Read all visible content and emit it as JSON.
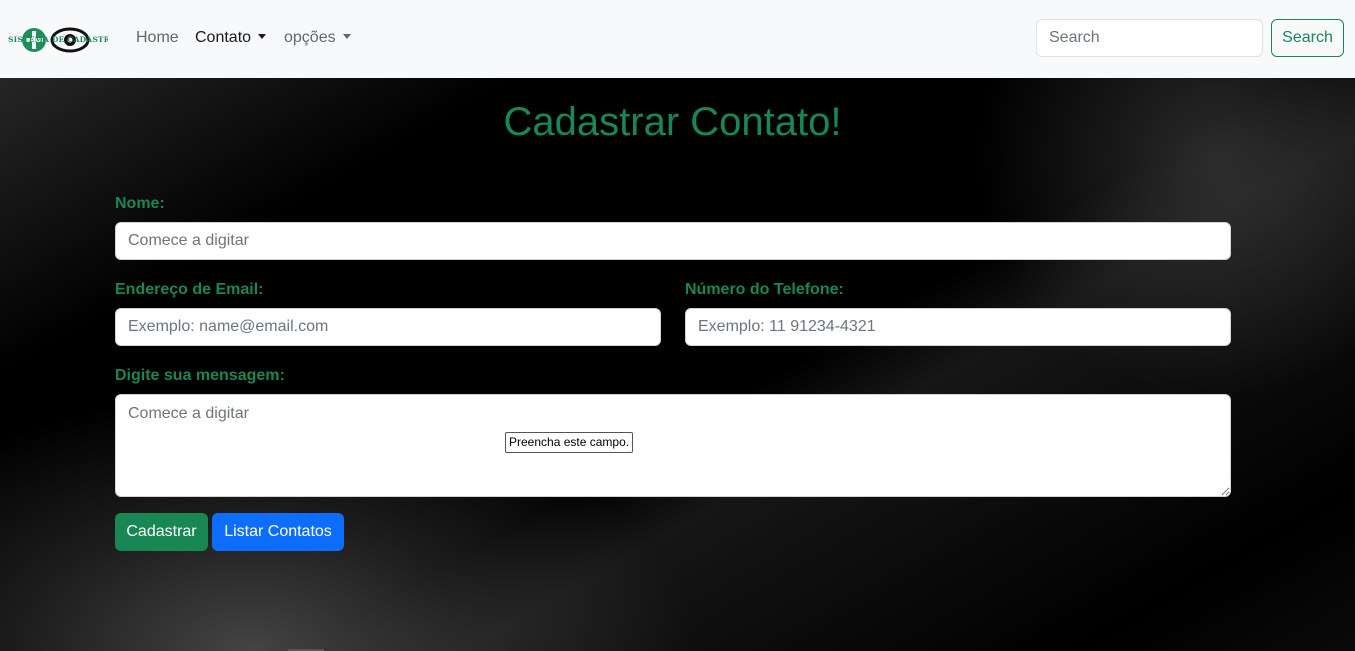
{
  "navbar": {
    "logo_text": "SISTEMA DE CADASTRO",
    "links": [
      "Home",
      "Contato",
      "opções"
    ],
    "search_placeholder": "Search",
    "search_button": "Search"
  },
  "form": {
    "title": "Cadastrar Contato!",
    "name_label": "Nome:",
    "name_placeholder": "Comece a digitar",
    "email_label": "Endereço de Email:",
    "email_placeholder": "Exemplo: name@email.com",
    "phone_label": "Número do Telefone:",
    "phone_placeholder": "Exemplo: 11 91234-4321",
    "message_label": "Digite sua mensagem:",
    "message_placeholder": "Comece a digitar",
    "validation_tooltip": "Preencha este campo.",
    "submit_button": "Cadastrar",
    "list_button": "Listar Contatos"
  },
  "colors": {
    "accent_green": "#198754",
    "primary_blue": "#0d6efd",
    "navbar_bg": "#f8f9fa"
  }
}
